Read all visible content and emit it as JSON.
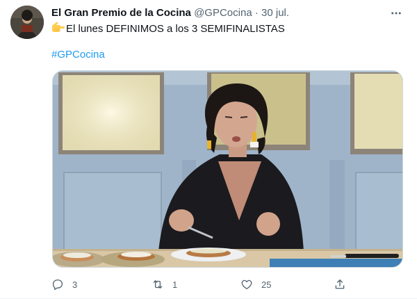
{
  "tweet": {
    "author_name": "El Gran Premio de la Cocina",
    "handle": "@GPCocina",
    "separator": "·",
    "date": "30 jul.",
    "emoji": "backhand-index-pointing-right",
    "text": "El lunes DEFINIMOS a los 3 SEMIFINALISTAS",
    "hashtag": "#GPCocina",
    "media_description": "video frame",
    "actions": {
      "replies": "3",
      "retweets": "1",
      "likes": "25"
    },
    "icons": {
      "reply": "reply-icon",
      "retweet": "retweet-icon",
      "like": "heart-icon",
      "share": "share-icon",
      "more": "more-icon"
    },
    "colors": {
      "accent": "#1d9bf0",
      "secondary_text": "#536471",
      "primary_text": "#0f1419"
    }
  }
}
